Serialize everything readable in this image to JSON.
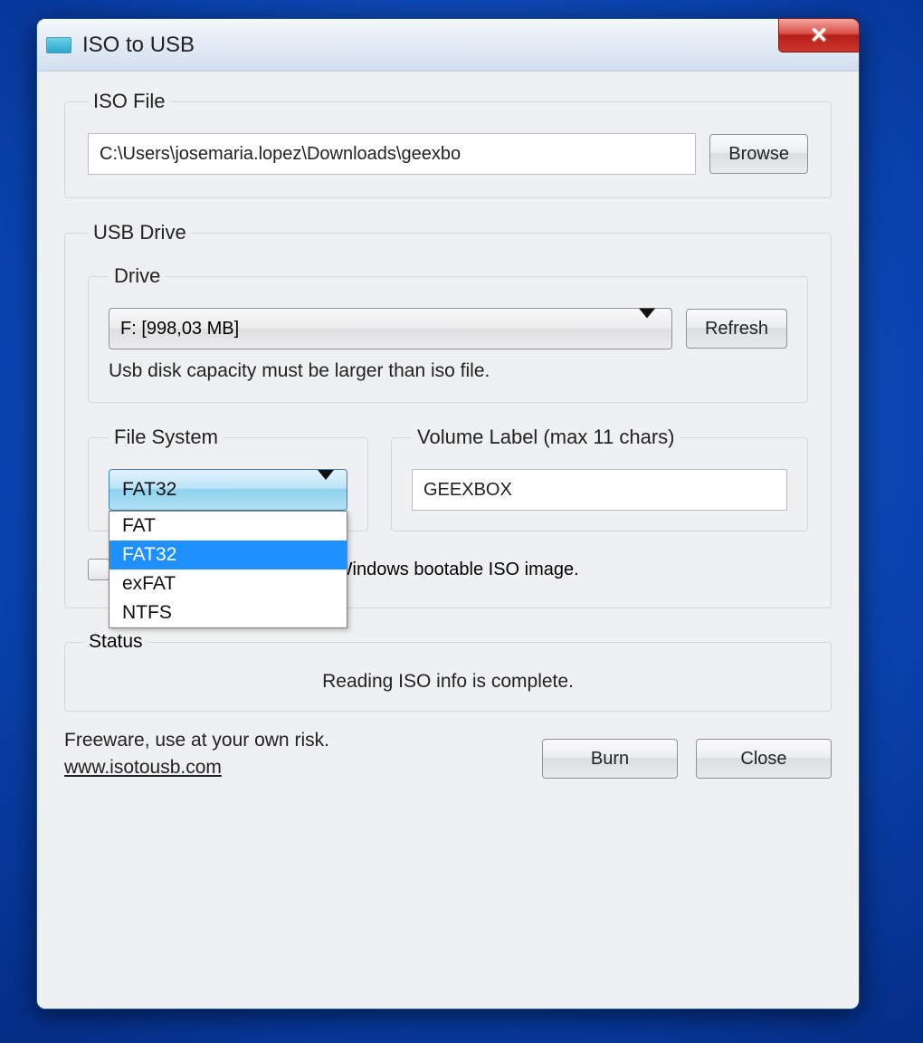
{
  "window": {
    "title": "ISO to USB"
  },
  "iso_file": {
    "legend": "ISO File",
    "path": "C:\\Users\\josemaria.lopez\\Downloads\\geexbo",
    "browse": "Browse"
  },
  "usb_drive": {
    "legend": "USB Drive",
    "drive_legend": "Drive",
    "drive_selected": "F: [998,03 MB]",
    "refresh": "Refresh",
    "capacity_note": "Usb disk capacity must be larger than iso file.",
    "file_system": {
      "legend": "File System",
      "selected": "FAT32",
      "options": [
        "FAT",
        "FAT32",
        "exFAT",
        "NTFS"
      ]
    },
    "volume_label": {
      "legend": "Volume Label (max 11 chars)",
      "value": "GEEXBOX"
    },
    "bootable_text": "pports Windows bootable ISO image."
  },
  "status": {
    "legend": "Status",
    "text": "Reading ISO info is complete."
  },
  "footer": {
    "risk": "Freeware, use at your own risk.",
    "link": "www.isotousb.com",
    "burn": "Burn",
    "close": "Close"
  }
}
